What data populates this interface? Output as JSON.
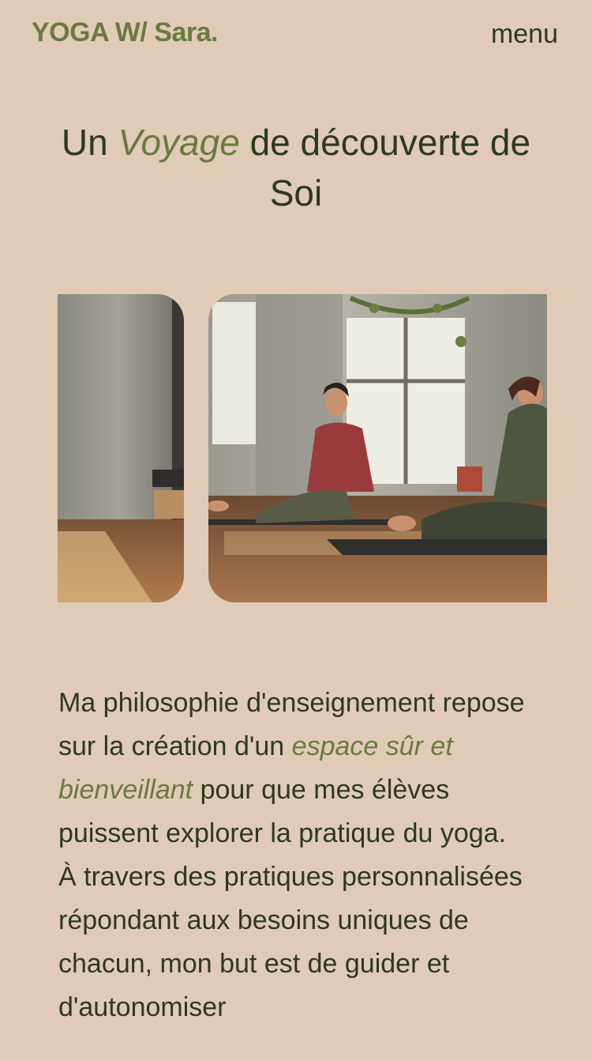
{
  "header": {
    "logo": "YOGA W/ Sara.",
    "menu_label": "menu"
  },
  "hero": {
    "title_part1": "Un ",
    "title_accent": "Voyage",
    "title_part2": " de découverte de Soi"
  },
  "gallery": {
    "images": [
      {
        "name": "studio-column-photo"
      },
      {
        "name": "yoga-class-photo"
      }
    ]
  },
  "philosophy": {
    "p1_part1": "Ma philosophie d'enseignement repose sur la création d'un ",
    "p1_accent": "espace sûr et bienveillant",
    "p1_part2": " pour que mes élèves puissent explorer la pratique du yoga.",
    "p2": "À travers des pratiques personnalisées répondant aux besoins uniques de chacun, mon but est de guider et d'autonomiser"
  },
  "colors": {
    "background": "#dfcbb6",
    "accent": "#6b7a3f",
    "text": "#2d3a1c"
  }
}
